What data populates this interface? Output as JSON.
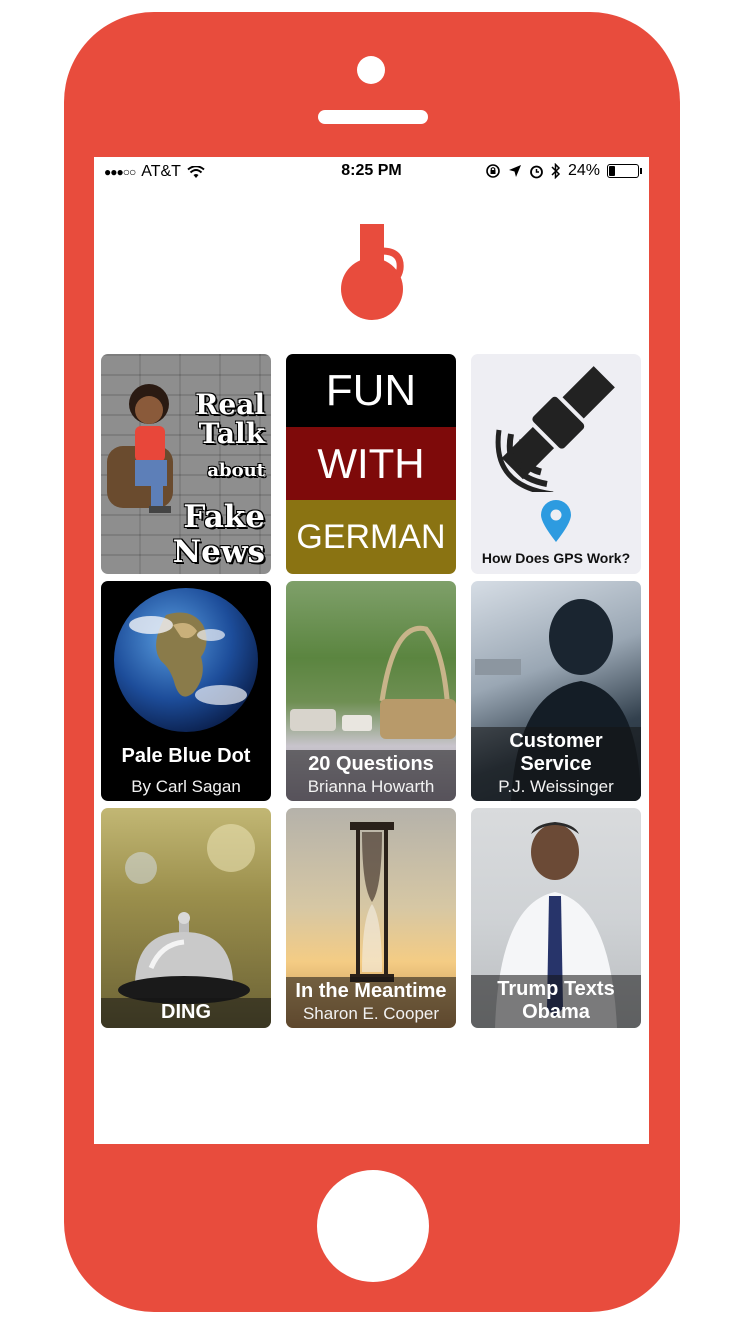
{
  "status_bar": {
    "carrier": "AT&T",
    "time": "8:25 PM",
    "battery": "24%",
    "battery_level": 0.24
  },
  "colors": {
    "frame": "#e84c3d",
    "accent": "#e84c3d",
    "gps_pin": "#2d9be0"
  },
  "tiles": [
    {
      "art_lines": [
        "Real",
        "Talk",
        "about",
        "Fake",
        "News"
      ]
    },
    {
      "art_lines": [
        "FUN",
        "WITH",
        "GERMAN"
      ]
    },
    {
      "caption": "How Does GPS Work?"
    },
    {
      "title": "Pale Blue Dot",
      "subtitle": "By Carl Sagan"
    },
    {
      "title": "20 Questions",
      "subtitle": "Brianna Howarth"
    },
    {
      "title": "Customer Service",
      "subtitle": "P.J. Weissinger"
    },
    {
      "title": "DING"
    },
    {
      "title": "In the Meantime",
      "subtitle": "Sharon E. Cooper"
    },
    {
      "title": "Trump Texts Obama"
    }
  ]
}
